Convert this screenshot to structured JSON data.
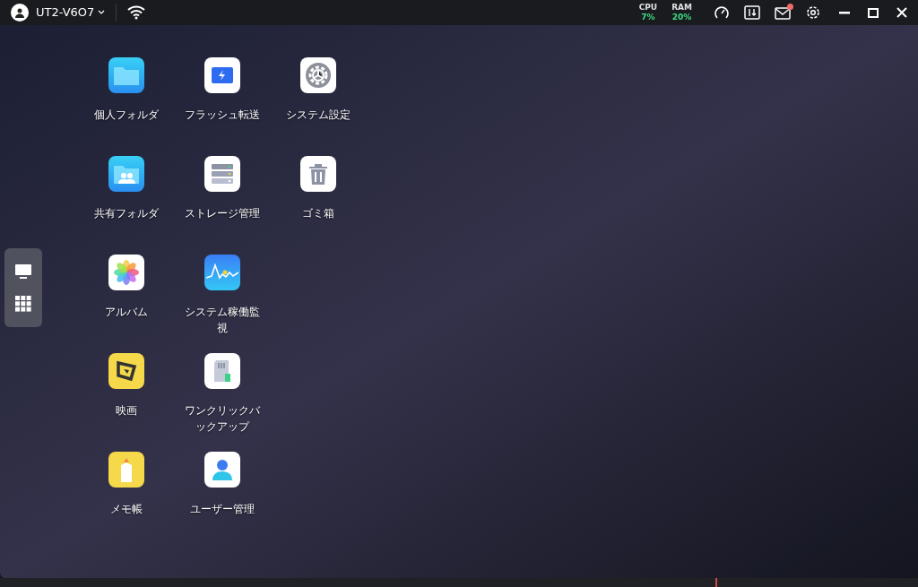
{
  "top_bar": {
    "device_name": "UT2-V6O7",
    "cpu": {
      "label": "CPU",
      "value": "7%"
    },
    "ram": {
      "label": "RAM",
      "value": "20%"
    },
    "mail_unread": true
  },
  "dock": [
    {
      "kind": "desktop"
    },
    {
      "kind": "apps"
    }
  ],
  "apps": [
    {
      "label": "個人フォルダ",
      "kind": "folder"
    },
    {
      "label": "フラッシュ転送",
      "kind": "flash"
    },
    {
      "label": "システム設定",
      "kind": "settings"
    },
    {
      "label": "共有フォルダ",
      "kind": "shared"
    },
    {
      "label": "ストレージ管理",
      "kind": "storage"
    },
    {
      "label": "ゴミ箱",
      "kind": "trash"
    },
    {
      "label": "アルバム",
      "kind": "album"
    },
    {
      "label": "システム稼働監視",
      "kind": "monitor"
    },
    {
      "kind": "none"
    },
    {
      "label": "映画",
      "kind": "movie"
    },
    {
      "label": "ワンクリックバックアップ",
      "kind": "backup"
    },
    {
      "kind": "none"
    },
    {
      "label": "メモ帳",
      "kind": "notes"
    },
    {
      "label": "ユーザー管理",
      "kind": "user"
    }
  ]
}
